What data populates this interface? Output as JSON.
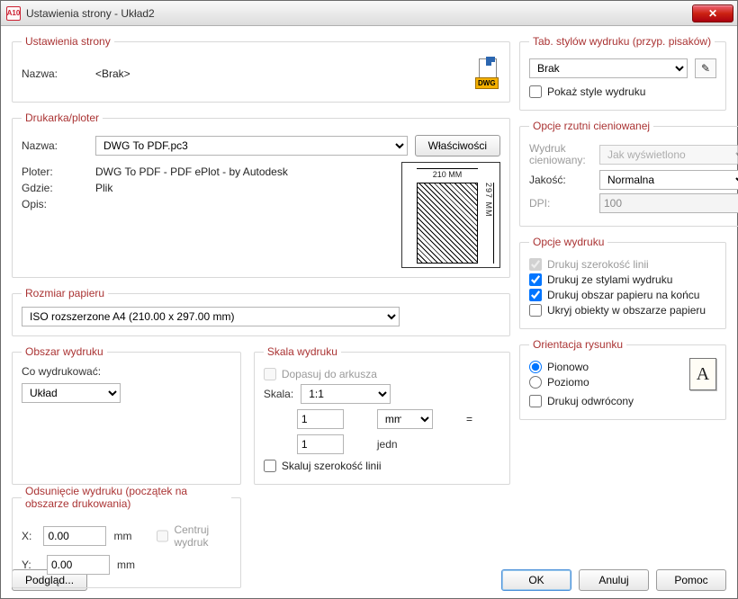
{
  "titlebar": {
    "title": "Ustawienia strony - Układ2",
    "app_icon_text": "A10"
  },
  "pageSetup": {
    "legend": "Ustawienia strony",
    "name_label": "Nazwa:",
    "name_value": "<Brak>",
    "dwg_tag": "DWG"
  },
  "printer": {
    "legend": "Drukarka/ploter",
    "name_label": "Nazwa:",
    "name_value": "DWG To PDF.pc3",
    "props_button": "Właściwości",
    "plotter_label": "Ploter:",
    "plotter_value": "DWG To PDF - PDF ePlot - by Autodesk",
    "where_label": "Gdzie:",
    "where_value": "Plik",
    "desc_label": "Opis:",
    "desc_value": "",
    "preview_top": "210 MM",
    "preview_right": "297 MM"
  },
  "paperSize": {
    "legend": "Rozmiar papieru",
    "value": "ISO rozszerzone A4 (210.00 x 297.00 mm)"
  },
  "plotArea": {
    "legend": "Obszar wydruku",
    "what_label": "Co wydrukować:",
    "what_value": "Układ"
  },
  "scale": {
    "legend": "Skala wydruku",
    "fit_label": "Dopasuj do arkusza",
    "scale_label": "Skala:",
    "scale_value": "1:1",
    "num": "1",
    "unit_top": "mm",
    "equals": "=",
    "denom": "1",
    "unit_bottom": "jedn",
    "scale_lw_label": "Skaluj szerokość linii"
  },
  "offset": {
    "legend": "Odsunięcie wydruku (początek na obszarze drukowania)",
    "x_label": "X:",
    "x_value": "0.00",
    "y_label": "Y:",
    "y_value": "0.00",
    "unit": "mm",
    "center_label": "Centruj wydruk"
  },
  "plotStyles": {
    "legend": "Tab. stylów wydruku (przyp. pisaków)",
    "value": "Brak",
    "show_label": "Pokaż style wydruku"
  },
  "shaded": {
    "legend": "Opcje rzutni cieniowanej",
    "shade_label": "Wydruk cieniowany:",
    "shade_value": "Jak wyświetlono",
    "quality_label": "Jakość:",
    "quality_value": "Normalna",
    "dpi_label": "DPI:",
    "dpi_value": "100"
  },
  "plotOptions": {
    "legend": "Opcje wydruku",
    "lw_label": "Drukuj szerokość linii",
    "styles_label": "Drukuj ze stylami wydruku",
    "paperlast_label": "Drukuj obszar papieru na końcu",
    "hidepaper_label": "Ukryj obiekty w obszarze papieru"
  },
  "orientation": {
    "legend": "Orientacja rysunku",
    "portrait": "Pionowo",
    "landscape": "Poziomo",
    "upside_label": "Drukuj odwrócony",
    "letter": "A"
  },
  "footer": {
    "preview": "Podgląd...",
    "ok": "OK",
    "cancel": "Anuluj",
    "help": "Pomoc"
  }
}
